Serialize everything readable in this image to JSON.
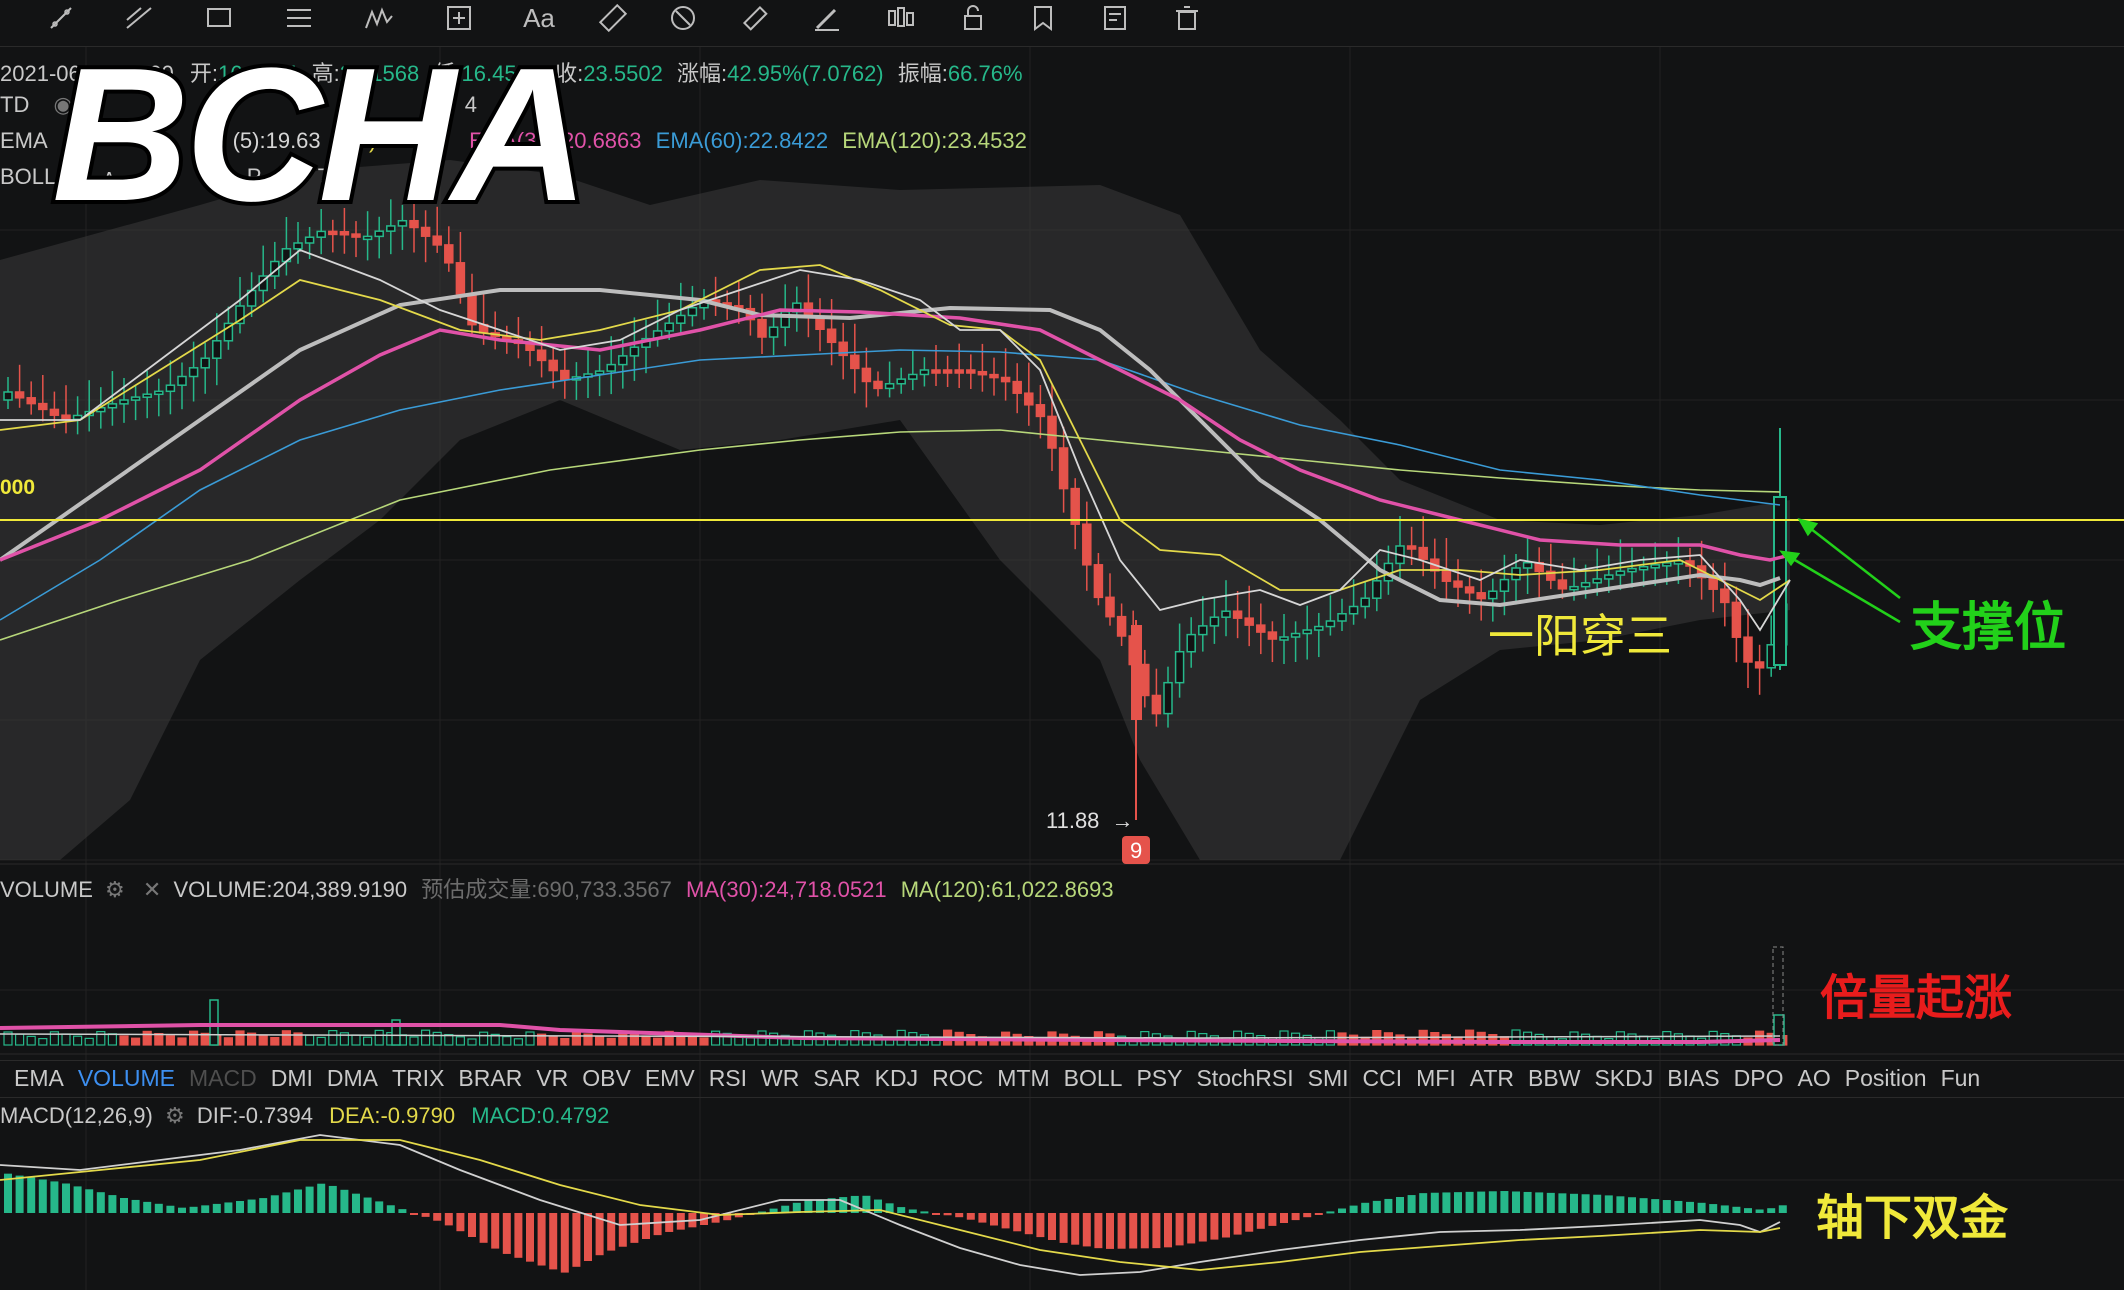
{
  "toolbar": {
    "tools": [
      "trend-line-icon",
      "multi-line-icon",
      "rectangle-icon",
      "parallel-lines-icon",
      "wave-icon",
      "add-frame-icon",
      "text-icon",
      "ruler-icon",
      "magnet-icon",
      "eraser-icon",
      "pen-icon",
      "candles-icon",
      "lock-icon",
      "bookmark-icon",
      "note-icon",
      "trash-icon"
    ],
    "text_tool_label": "Aa"
  },
  "ohlc": {
    "date": "2021-06-24 08:00",
    "open_label": "开:",
    "open": "16.4524",
    "high_label": "高:",
    "high": "27.1568",
    "low_label": "低:",
    "low": "16.4513",
    "close_label": "收:",
    "close": "23.5502",
    "change_label": "涨幅:",
    "change": "42.95%(7.0762)",
    "amp_label": "振幅:",
    "amp": "66.76%"
  },
  "td_row": {
    "label": "TD",
    "value": "4"
  },
  "ema_row": {
    "label": "EMA",
    "ema5": "(5):19.63",
    "ema10": "0):1",
    "ema10b": "6",
    "ema30": "EMA(30):20.6863",
    "ema60": "EMA(60):22.8422",
    "ema120": "EMA(120):23.4532"
  },
  "boll_row": {
    "label": "BOLL",
    "p1": "ʌ",
    "p2": "P",
    "p3": "714"
  },
  "price_line_label": "000",
  "low_marker": {
    "value": "11.88",
    "arrow": "→",
    "td_count": "9"
  },
  "big_title": "BCHA",
  "annotations": {
    "support": "支撑位",
    "one_yang": "一阳穿三",
    "volume_up": "倍量起涨",
    "macd_gold": "轴下双金"
  },
  "volume_row": {
    "label": "VOLUME",
    "value": "VOLUME:204,389.9190",
    "estimate": "预估成交量:690,733.3567",
    "ma30": "MA(30):24,718.0521",
    "ma120": "MA(120):61,022.8693"
  },
  "tabs": [
    "EMA",
    "VOLUME",
    "MACD",
    "DMI",
    "DMA",
    "TRIX",
    "BRAR",
    "VR",
    "OBV",
    "EMV",
    "RSI",
    "WR",
    "SAR",
    "KDJ",
    "ROC",
    "MTM",
    "BOLL",
    "PSY",
    "StochRSI",
    "SMI",
    "CCI",
    "MFI",
    "ATR",
    "BBW",
    "SKDJ",
    "BIAS",
    "DPO",
    "AO",
    "Position",
    "Fun"
  ],
  "active_tab": "VOLUME",
  "dim_tab": "MACD",
  "macd_row": {
    "label": "MACD(12,26,9)",
    "dif": "DIF:-0.7394",
    "dea": "DEA:-0.9790",
    "macd": "MACD:0.4792"
  },
  "colors": {
    "up": "#26b88a",
    "down": "#e5534b",
    "ema5": "#cfcfcf",
    "ema10": "#e3d94a",
    "ema30": "#e052a8",
    "ema60": "#3a9bd6",
    "ema120": "#b7d77a",
    "boll_mid": "#bdbdbd",
    "support_line": "#f0e93a",
    "annotation_green": "#22d11a",
    "annotation_yellow": "#f0e93a",
    "annotation_red": "#e81c1c"
  },
  "chart_data": {
    "type": "candlestick",
    "title": "BCHA",
    "support_price": 19.0,
    "low_price": 11.88,
    "last_candle": {
      "date": "2021-06-24 08:00",
      "open": 16.4524,
      "high": 27.1568,
      "low": 16.4513,
      "close": 23.5502
    },
    "ema": {
      "ema30": 20.6863,
      "ema60": 22.8422,
      "ema120": 23.4532
    },
    "volume": {
      "last": 204389.919,
      "estimate": 690733.3567,
      "ma30": 24718.0521,
      "ma120": 61022.8693
    },
    "macd": {
      "params": [
        12,
        26,
        9
      ],
      "dif": -0.7394,
      "dea": -0.979,
      "macd": 0.4792
    }
  }
}
